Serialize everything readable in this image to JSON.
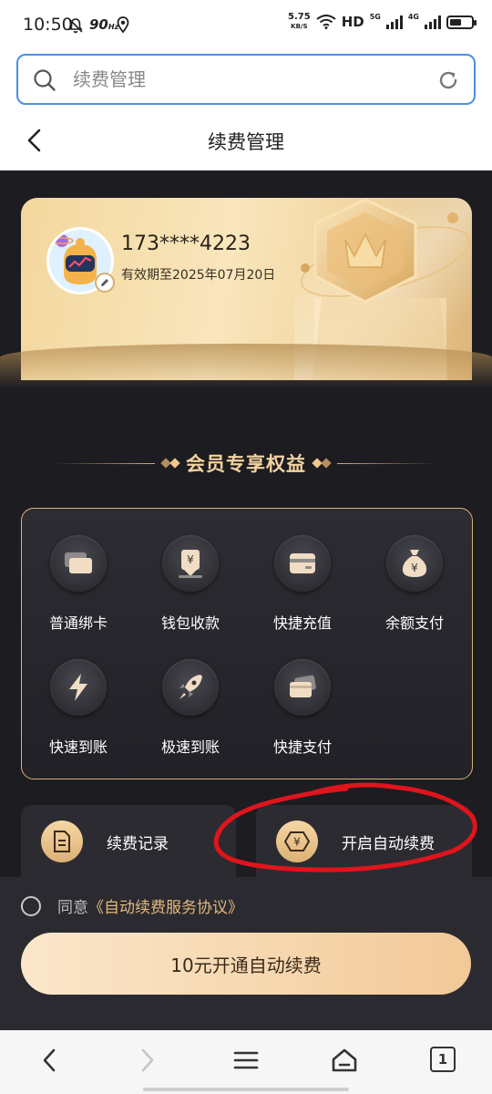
{
  "status_bar": {
    "time": "10:50",
    "refresh_rate": "90",
    "refresh_unit": "Hz",
    "net_speed_value": "5.75",
    "net_speed_unit": "KB/S",
    "hd_label": "HD",
    "sim1_label": "5G",
    "sim2_label": "4G",
    "battery_level": 0.55
  },
  "search": {
    "placeholder": "续费管理"
  },
  "header": {
    "title": "续费管理"
  },
  "member_card": {
    "phone": "173****4223",
    "valid_until": "有效期至2025年07月20日"
  },
  "benefits": {
    "title": "会员专享权益",
    "items": [
      {
        "label": "普通绑卡",
        "icon": "card-stack-icon"
      },
      {
        "label": "钱包收款",
        "icon": "wallet-download-icon"
      },
      {
        "label": "快捷充值",
        "icon": "card-icon"
      },
      {
        "label": "余额支付",
        "icon": "money-bag-icon"
      },
      {
        "label": "快速到账",
        "icon": "lightning-icon"
      },
      {
        "label": "极速到账",
        "icon": "rocket-icon"
      },
      {
        "label": "快捷支付",
        "icon": "card-pay-icon"
      }
    ]
  },
  "actions": {
    "records_label": "续费记录",
    "auto_renew_label": "开启自动续费"
  },
  "agreement": {
    "prefix": "同意",
    "link": "《自动续费服务协议》"
  },
  "cta": {
    "label": "10元开通自动续费"
  },
  "colors": {
    "accent_gold": "#e3b97c",
    "dark_bg": "#1c1c21",
    "search_border": "#4a90e2",
    "annotation_red": "#e0141c"
  },
  "tab_count": "1"
}
